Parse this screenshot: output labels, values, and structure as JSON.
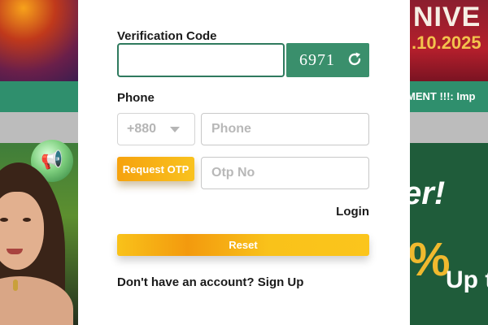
{
  "background": {
    "right_banner_title": "NIVE",
    "right_banner_date": ".10.2025",
    "marquee_text": "MENT !!!: Imp",
    "promo_text": "er!",
    "promo_percent": "%",
    "promo_upto": "Up t"
  },
  "form": {
    "verification": {
      "label": "Verification Code",
      "value": "",
      "captcha_code": "6971",
      "refresh_icon": "refresh-icon"
    },
    "phone": {
      "label": "Phone",
      "country_code": "+880",
      "placeholder": "Phone",
      "value": ""
    },
    "otp": {
      "button_label": "Request OTP",
      "placeholder": "Otp No",
      "value": ""
    },
    "login_link": "Login",
    "reset_button": "Reset",
    "signup_prompt": "Don't have an account?",
    "signup_link": "Sign Up"
  },
  "colors": {
    "accent_green": "#3a8f6c",
    "button_gradient_start": "#f6a20e",
    "button_gradient_end": "#f9c21e"
  }
}
